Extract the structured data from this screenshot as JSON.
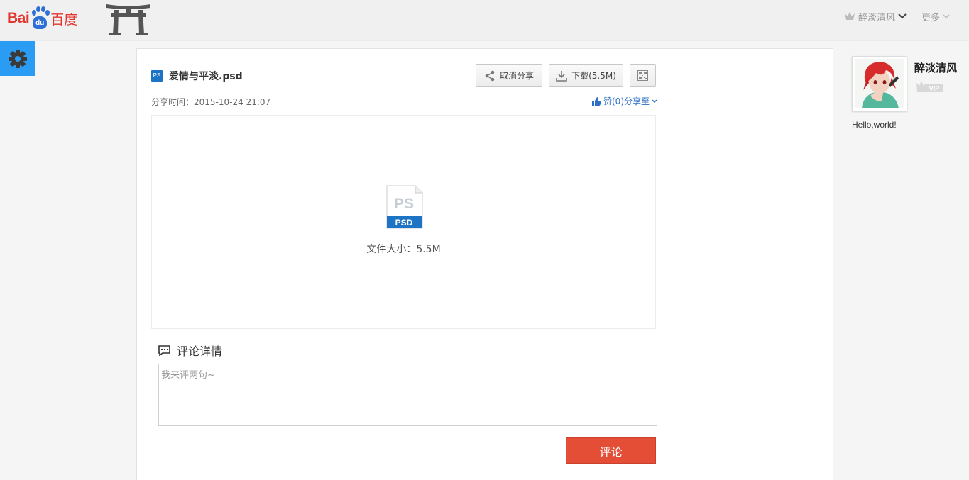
{
  "brand": {
    "logo_left": "Bai",
    "logo_paw": "du",
    "logo_right": "百度"
  },
  "header": {
    "username": "醉淡清风",
    "more_label": "更多"
  },
  "file": {
    "name": "爱情与平淡.psd",
    "share_time_label": "分享时间：",
    "share_time": "2015-10-24 21:07",
    "like_share_label": "赞(0)分享至",
    "size_label": "文件大小：5.5M",
    "icon_text_top": "PS",
    "icon_text_bottom": "PSD",
    "small_icon_text": "PS"
  },
  "toolbar": {
    "unshare_label": "取消分享",
    "download_label": "下载(5.5M)"
  },
  "comments": {
    "heading": "评论详情",
    "placeholder": "我来评两句~",
    "submit_label": "评论"
  },
  "profile": {
    "name": "醉淡清风",
    "vip_label": "VIP",
    "bio": "Hello,world!"
  },
  "colors": {
    "accent_blue": "#2a9cf4",
    "brand_red": "#e1372f",
    "comment_button": "#e44d36",
    "link_blue": "#2d6fc5"
  }
}
